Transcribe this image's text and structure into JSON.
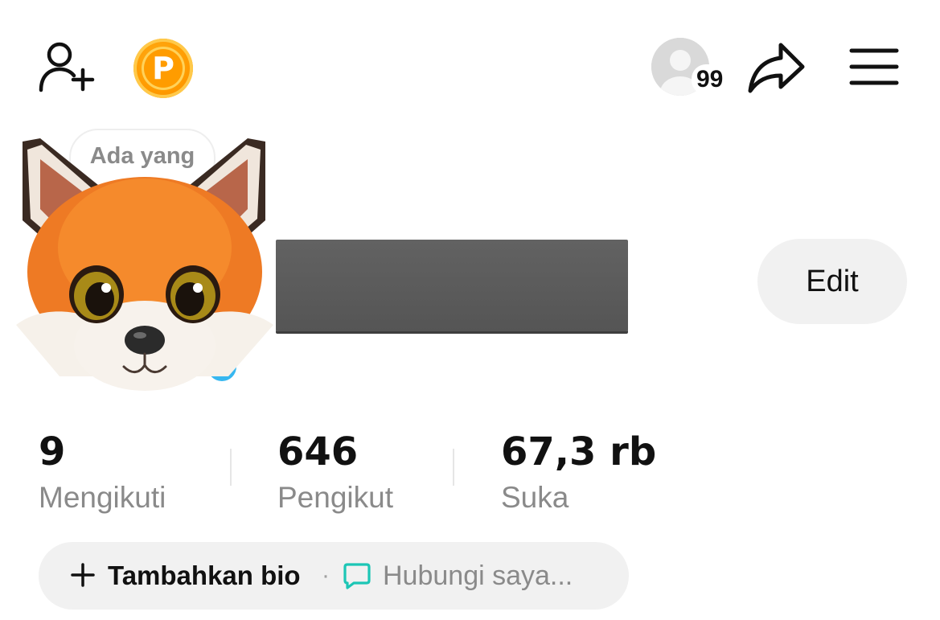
{
  "header": {
    "add_friend_icon": "person-plus-icon",
    "coin_icon": "coin-icon",
    "coin_letter": "P",
    "profile_views_count": "99",
    "share_icon": "share-arrow-icon",
    "menu_icon": "hamburger-menu-icon"
  },
  "profile": {
    "speech_bubble": "Ada yang seru?",
    "edit_label": "Edit",
    "avatar_icon": "fox-avatar"
  },
  "stats": [
    {
      "value": "9",
      "label": "Mengikuti"
    },
    {
      "value": "646",
      "label": "Pengikut"
    },
    {
      "value": "67,3 rb",
      "label": "Suka"
    }
  ],
  "bio": {
    "add_label": "Tambahkan bio",
    "separator": "·",
    "contact_label": "Hubungi saya..."
  },
  "colors": {
    "accent_coin": "#ff9c00",
    "notification_dot": "#e8304e",
    "chat_icon": "#1cc6b5",
    "pill_background": "#f1f1f1",
    "muted_text": "#8a8a8a"
  }
}
